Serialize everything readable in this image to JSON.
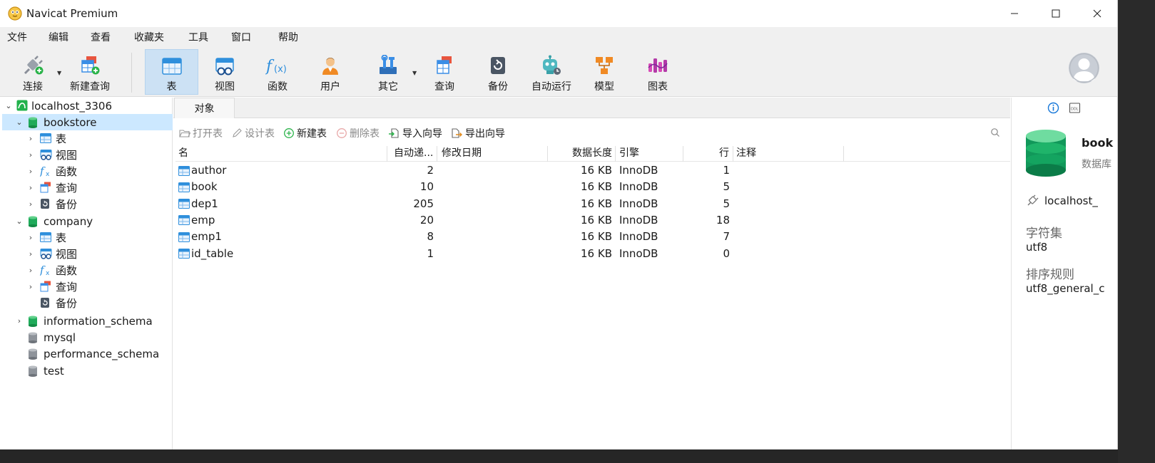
{
  "app": {
    "title": "Navicat Premium"
  },
  "menu": [
    "文件",
    "编辑",
    "查看",
    "收藏夹",
    "工具",
    "窗口",
    "帮助"
  ],
  "toolbar": {
    "connect": "连接",
    "new_query": "新建查询",
    "table": "表",
    "view": "视图",
    "function": "函数",
    "user": "用户",
    "other": "其它",
    "query": "查询",
    "backup": "备份",
    "automation": "自动运行",
    "model": "模型",
    "chart": "图表"
  },
  "tree": {
    "connection": "localhost_3306",
    "db1": {
      "name": "bookstore",
      "children": [
        "表",
        "视图",
        "函数",
        "查询",
        "备份"
      ]
    },
    "db2": {
      "name": "company",
      "children": [
        "表",
        "视图",
        "函数",
        "查询",
        "备份"
      ]
    },
    "others": [
      "information_schema",
      "mysql",
      "performance_schema",
      "test"
    ]
  },
  "tabs": {
    "objects": "对象"
  },
  "object_toolbar": {
    "open": "打开表",
    "design": "设计表",
    "new": "新建表",
    "delete": "删除表",
    "import": "导入向导",
    "export": "导出向导"
  },
  "grid": {
    "columns": [
      "名",
      "自动递...",
      "修改日期",
      "数据长度",
      "引擎",
      "行",
      "注释"
    ],
    "rows": [
      {
        "name": "author",
        "auto_inc": "2",
        "modified": "",
        "data_length": "16 KB",
        "engine": "InnoDB",
        "rows": "1",
        "comment": ""
      },
      {
        "name": "book",
        "auto_inc": "10",
        "modified": "",
        "data_length": "16 KB",
        "engine": "InnoDB",
        "rows": "5",
        "comment": ""
      },
      {
        "name": "dep1",
        "auto_inc": "205",
        "modified": "",
        "data_length": "16 KB",
        "engine": "InnoDB",
        "rows": "5",
        "comment": ""
      },
      {
        "name": "emp",
        "auto_inc": "20",
        "modified": "",
        "data_length": "16 KB",
        "engine": "InnoDB",
        "rows": "18",
        "comment": ""
      },
      {
        "name": "emp1",
        "auto_inc": "8",
        "modified": "",
        "data_length": "16 KB",
        "engine": "InnoDB",
        "rows": "7",
        "comment": ""
      },
      {
        "name": "id_table",
        "auto_inc": "1",
        "modified": "",
        "data_length": "16 KB",
        "engine": "InnoDB",
        "rows": "0",
        "comment": ""
      }
    ]
  },
  "info_panel": {
    "title": "book",
    "subtitle": "数据库",
    "connection": "localhost_",
    "charset_label": "字符集",
    "charset_value": "utf8",
    "collation_label": "排序规则",
    "collation_value": "utf8_general_c"
  },
  "colors": {
    "selection": "#cce8ff",
    "active_tool": "#cce1f4",
    "db_green": "#1faa5a",
    "table_blue": "#2f8fdc"
  }
}
